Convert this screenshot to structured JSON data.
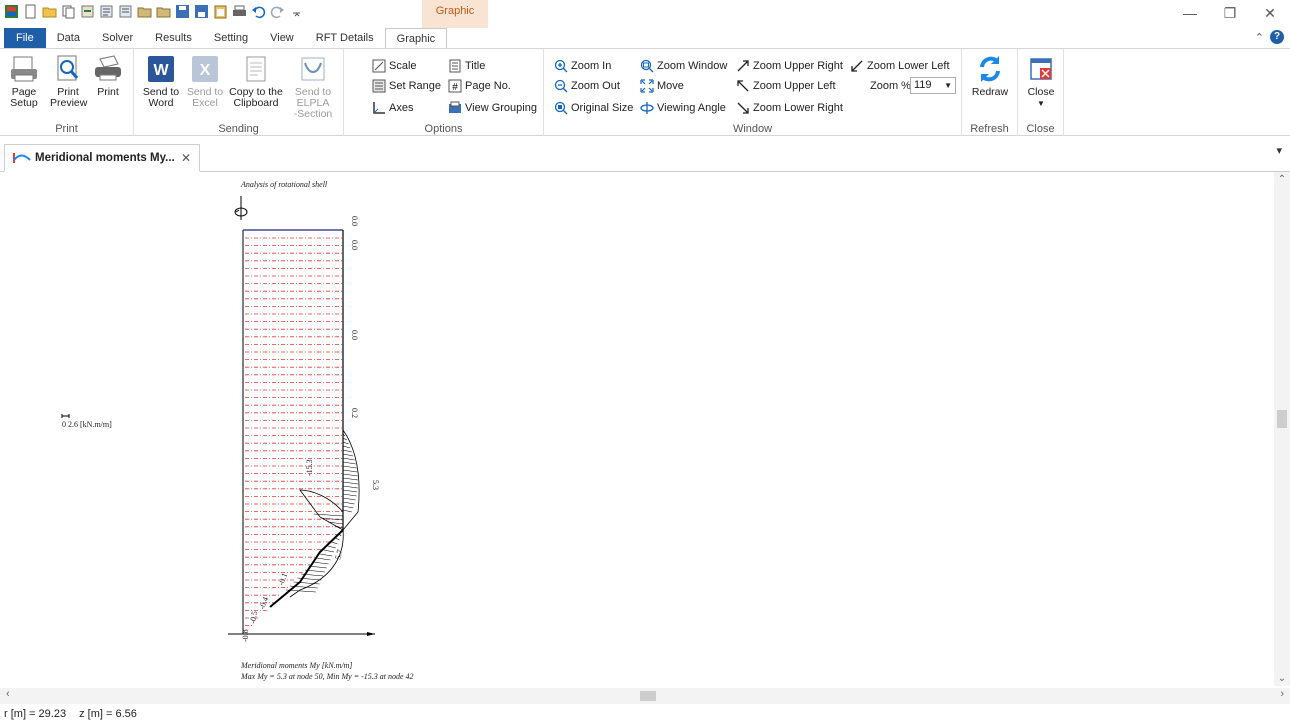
{
  "titlebar": {
    "context_label": "Graphic",
    "qat_icons": [
      "app-icon",
      "new-icon",
      "open-icon",
      "copy-icon",
      "import-icon",
      "export-icon",
      "export2-icon",
      "folder-icon",
      "folder2-icon",
      "save-icon",
      "saveas-icon",
      "clipboard-icon",
      "print-icon",
      "undo-icon",
      "redo-icon",
      "customize-icon"
    ]
  },
  "tabs": [
    "File",
    "Data",
    "Solver",
    "Results",
    "Setting",
    "View",
    "RFT Details",
    "Graphic"
  ],
  "ribbon": {
    "print": {
      "label": "Print",
      "page_setup": "Page\nSetup",
      "print_preview": "Print\nPreview",
      "print": "Print"
    },
    "sending": {
      "label": "Sending",
      "send_word": "Send to\nWord",
      "send_excel": "Send to\nExcel",
      "copy_clipboard": "Copy to the\nClipboard",
      "send_elpla": "Send to ELPLA\n-Section"
    },
    "options": {
      "label": "Options",
      "scale": "Scale",
      "set_range": "Set Range",
      "axes": "Axes",
      "title": "Title",
      "page_no": "Page No.",
      "view_grouping": "View Grouping"
    },
    "window": {
      "label": "Window",
      "zoom_in": "Zoom In",
      "zoom_out": "Zoom Out",
      "original_size": "Original Size",
      "zoom_window": "Zoom Window",
      "move": "Move",
      "viewing_angle": "Viewing Angle",
      "zoom_upper_right": "Zoom Upper Right",
      "zoom_upper_left": "Zoom Upper Left",
      "zoom_lower_right": "Zoom Lower Right",
      "zoom_lower_left": "Zoom Lower Left",
      "zoom_pct_label": "Zoom %",
      "zoom_pct_value": "119"
    },
    "refresh": {
      "label": "Refresh",
      "redraw": "Redraw"
    },
    "close": {
      "label": "Close",
      "close": "Close"
    }
  },
  "document_tab": {
    "title": "Meridional moments My..."
  },
  "graphic": {
    "heading": "Analysis of rotational shell",
    "scale_label": "0  2.6 [kN.m/m]",
    "values": [
      "0.0",
      "0.0",
      "0.0",
      "0.2",
      "5.3",
      "-15.3",
      "5.7",
      "-0.1",
      "-0.4",
      "-0.5",
      "-0.8"
    ],
    "caption_1": "Meridional moments My [kN.m/m]",
    "caption_2": "Max My = 5.3 at node 50, Min My = -15.3 at node 42"
  },
  "status": {
    "r": "r [m] = 29.23",
    "z": "z [m] = 6.56"
  }
}
